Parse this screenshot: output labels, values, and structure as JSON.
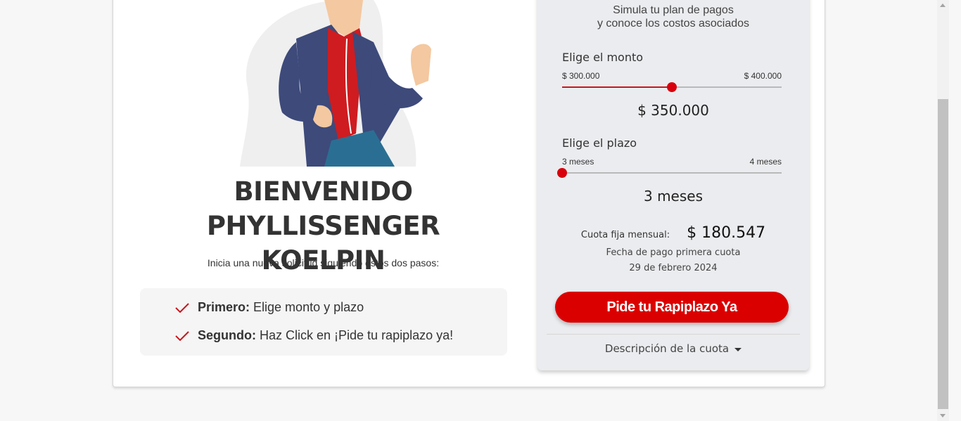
{
  "welcome": {
    "title_line1": "BIENVENIDO PHYLLISSENGER",
    "title_line2": "KOELPIN",
    "subtitle": "Inicia una nueva solicitud siguiendo estos dos pasos:",
    "steps": [
      {
        "label": "Primero:",
        "text": "Elige monto y plazo"
      },
      {
        "label": "Segundo:",
        "text": "Haz Click en ¡Pide tu rapiplazo ya!"
      }
    ]
  },
  "simulator": {
    "heading_line1": "Simula tu plan de pagos",
    "heading_line2": "y conoce los costos asociados",
    "amount": {
      "label": "Elige el monto",
      "min_label": "$ 300.000",
      "max_label": "$ 400.000",
      "value_label": "$ 350.000",
      "fraction": 0.5
    },
    "term": {
      "label": "Elige el plazo",
      "min_label": "3 meses",
      "max_label": "4 meses",
      "value_label": "3 meses",
      "fraction": 0
    },
    "cuota_label": "Cuota fija mensual:",
    "cuota_value": "$ 180.547",
    "fecha_label": "Fecha de pago primera cuota",
    "fecha_value": "29 de febrero 2024",
    "cta_label": "Pide tu Rapiplazo Ya",
    "description_label": "Descripción de la cuota"
  },
  "colors": {
    "accent": "#db0000",
    "panel_bg": "#ebecef",
    "text": "#333333"
  },
  "icons": [
    "check-icon",
    "caret-down-icon"
  ]
}
